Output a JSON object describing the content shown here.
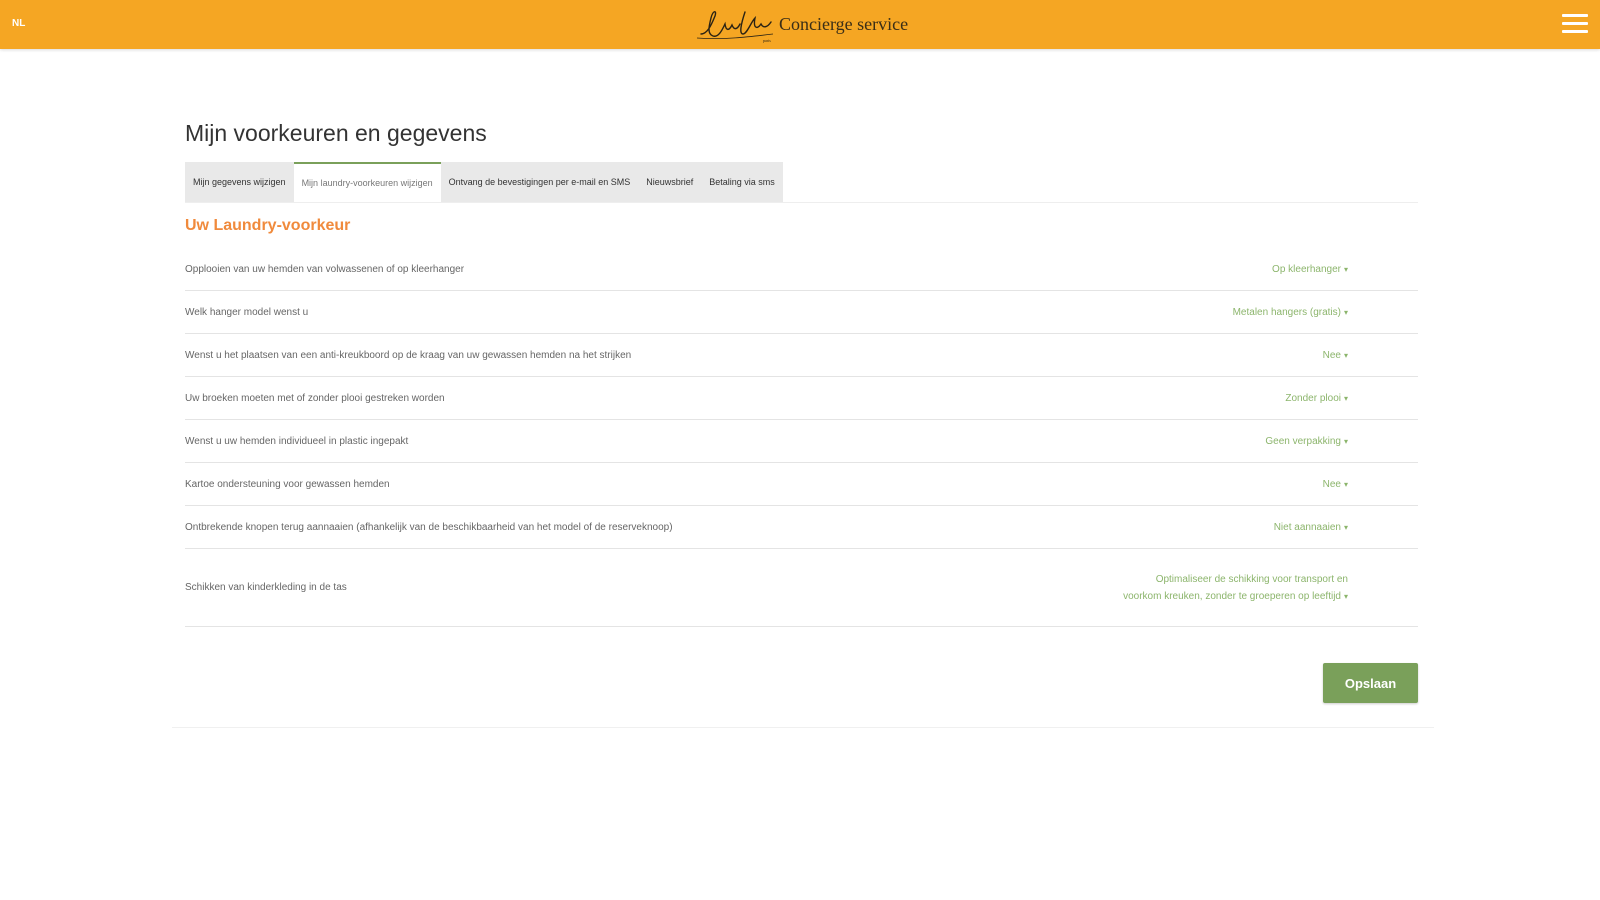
{
  "header": {
    "lang": "NL",
    "brand_text": "Concierge service",
    "colors": {
      "topbar": "#f5a623",
      "accent_green": "#7aa05a",
      "section_title": "#f08a3c"
    }
  },
  "page": {
    "title": "Mijn voorkeuren en gegevens",
    "tabs": [
      {
        "label": "Mijn gegevens wijzigen",
        "active": false
      },
      {
        "label": "Mijn laundry-voorkeuren wijzigen",
        "active": true
      },
      {
        "label": "Ontvang de bevestigingen per e-mail en SMS",
        "active": false
      },
      {
        "label": "Nieuwsbrief",
        "active": false
      },
      {
        "label": "Betaling via sms",
        "active": false
      }
    ],
    "section_title": "Uw Laundry-voorkeur",
    "preferences": [
      {
        "label": "Opplooien van uw hemden van volwassenen of op kleerhanger",
        "value": "Op kleerhanger"
      },
      {
        "label": "Welk hanger model wenst u",
        "value": "Metalen hangers (gratis)"
      },
      {
        "label": "Wenst u het plaatsen van een anti-kreukboord op de kraag van uw gewassen hemden na het strijken",
        "value": "Nee"
      },
      {
        "label": "Uw broeken moeten met of zonder plooi gestreken worden",
        "value": "Zonder plooi"
      },
      {
        "label": "Wenst u uw hemden individueel in plastic ingepakt",
        "value": "Geen verpakking"
      },
      {
        "label": "Kartoe ondersteuning voor gewassen hemden",
        "value": "Nee"
      },
      {
        "label": "Ontbrekende knopen terug aannaaien (afhankelijk van de beschikbaarheid van het model of de reserveknoop)",
        "value": "Niet aannaaien"
      },
      {
        "label": "Schikken van kinderkleding in de tas",
        "value": "Optimaliseer de schikking voor transport en voorkom kreuken, zonder te groeperen op leeftijd"
      }
    ],
    "save_label": "Opslaan"
  },
  "icons": {
    "menu": "hamburger-menu-icon",
    "logo": "signature-logo",
    "dropdown": "caret-down-icon"
  }
}
